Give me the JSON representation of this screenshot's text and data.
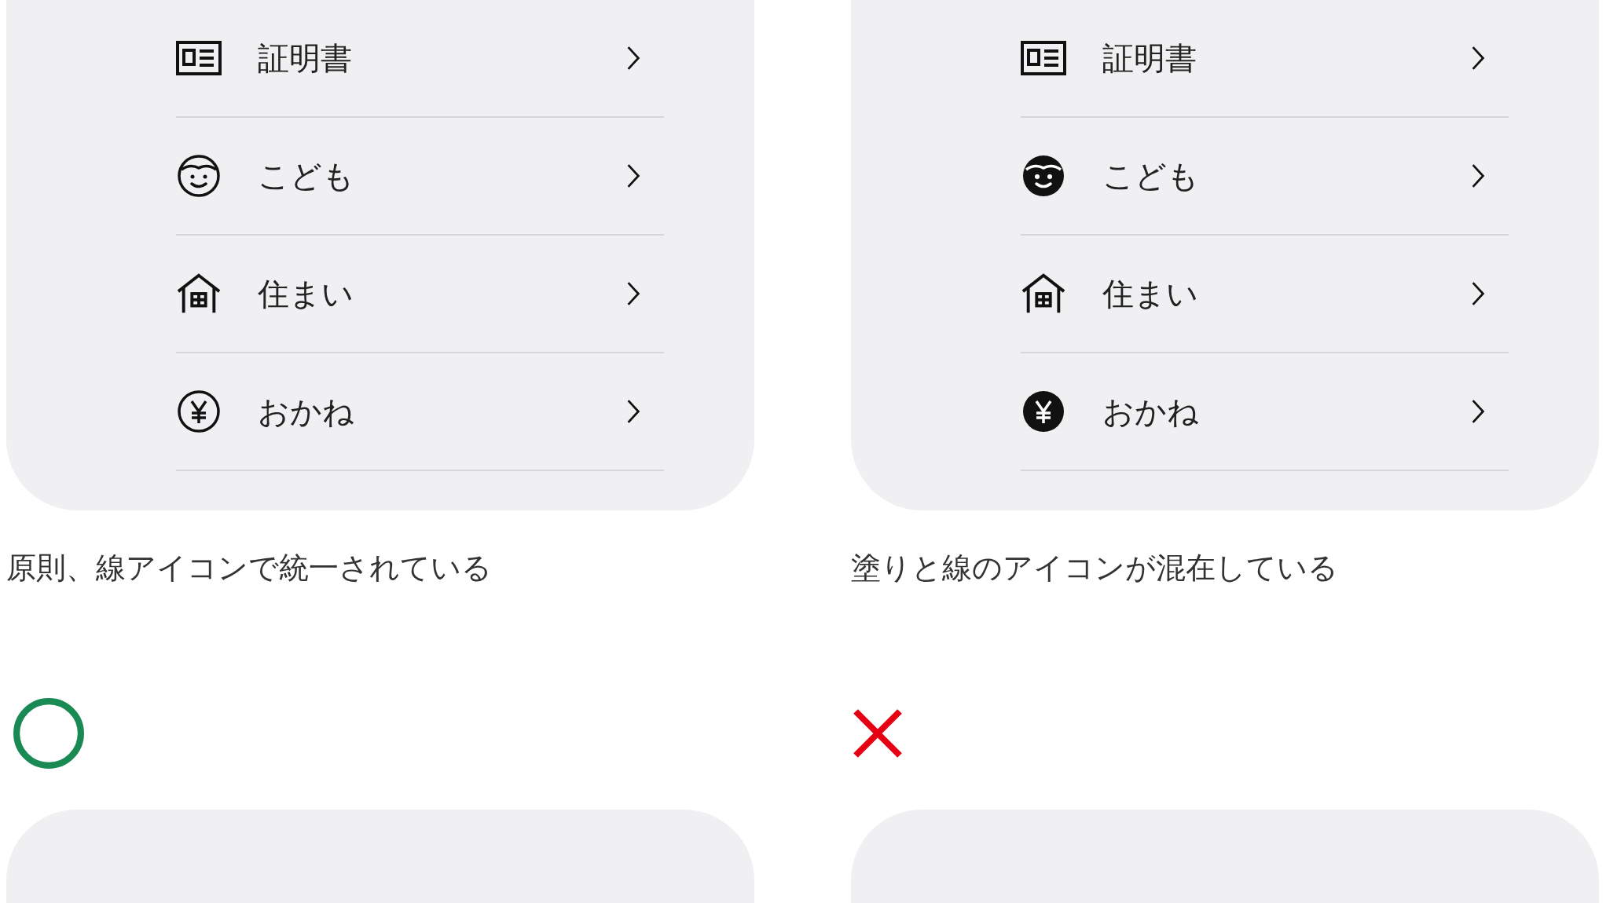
{
  "examples": [
    {
      "kind": "good",
      "caption": "原則、線アイコンで統一されている",
      "menu": [
        {
          "kind": "id-card",
          "filled": false,
          "label": "証明書"
        },
        {
          "kind": "child",
          "filled": false,
          "label": "こども"
        },
        {
          "kind": "house",
          "filled": false,
          "label": "住まい"
        },
        {
          "kind": "yen",
          "filled": false,
          "label": "おかね"
        }
      ]
    },
    {
      "kind": "bad",
      "caption": "塗りと線のアイコンが混在している",
      "menu": [
        {
          "kind": "id-card",
          "filled": false,
          "label": "証明書"
        },
        {
          "kind": "child",
          "filled": true,
          "label": "こども"
        },
        {
          "kind": "house",
          "filled": false,
          "label": "住まい"
        },
        {
          "kind": "yen",
          "filled": true,
          "label": "おかね"
        }
      ]
    }
  ]
}
